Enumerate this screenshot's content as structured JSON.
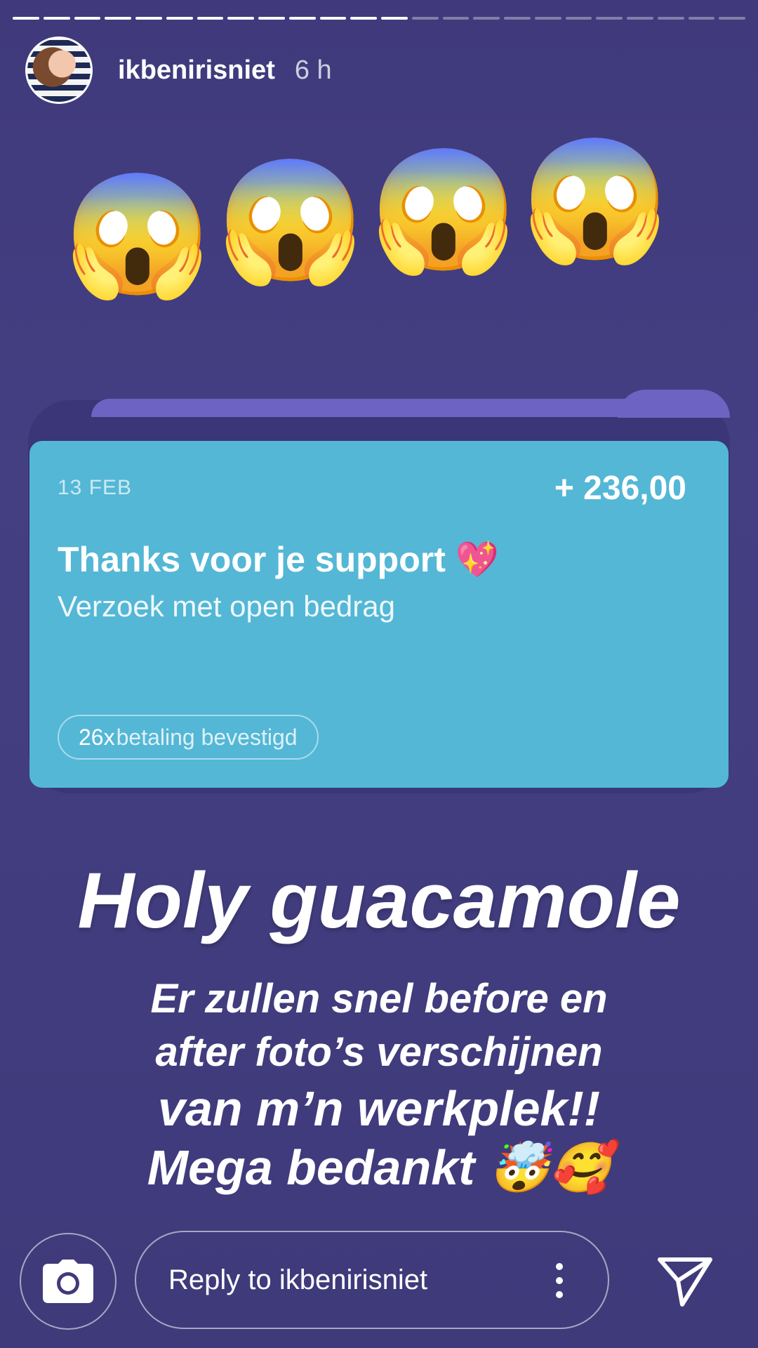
{
  "story": {
    "progress_segments_total": 24,
    "progress_segments_done": 13
  },
  "header": {
    "username": "ikbenirisniet",
    "time": "6 h"
  },
  "emojis": [
    "😱",
    "😱",
    "😱",
    "😱"
  ],
  "card": {
    "date": "13 FEB",
    "amount": "+ 236,00",
    "title": "Thanks voor je support 💖",
    "subtitle": "Verzoek met open bedrag",
    "badge_count": "26x",
    "badge_label": "betaling bevestigd"
  },
  "text": {
    "headline": "Holy guacamole",
    "line1": "Er zullen snel before en",
    "line2": "after foto’s verschijnen",
    "line3": "van m’n werkplek!!",
    "line4": "Mega bedankt 🤯🥰"
  },
  "footer": {
    "reply_placeholder": "Reply to ikbenirisniet",
    "camera_icon": "camera-icon",
    "send_icon": "send-icon",
    "more_icon": "more-vertical-icon"
  }
}
